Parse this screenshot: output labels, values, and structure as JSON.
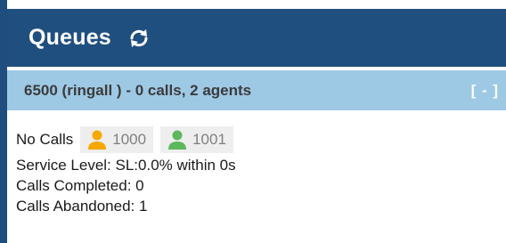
{
  "header": {
    "title": "Queues",
    "refresh_icon": "refresh-icon"
  },
  "queue": {
    "summary": "6500 (ringall ) - 0 calls, 2 agents",
    "collapse_label": "[ - ]",
    "status": "No Calls",
    "agents": [
      {
        "number": "1000",
        "icon": "agent-icon",
        "color": "#f5a800"
      },
      {
        "number": "1001",
        "icon": "agent-icon",
        "color": "#5cb85c"
      }
    ],
    "service_level": "Service Level: SL:0.0% within 0s",
    "calls_completed": "Calls Completed: 0",
    "calls_abandoned": "Calls Abandoned: 1"
  },
  "colors": {
    "header_bg": "#1f4f7f",
    "queue_bar_bg": "#9ec9e5"
  }
}
